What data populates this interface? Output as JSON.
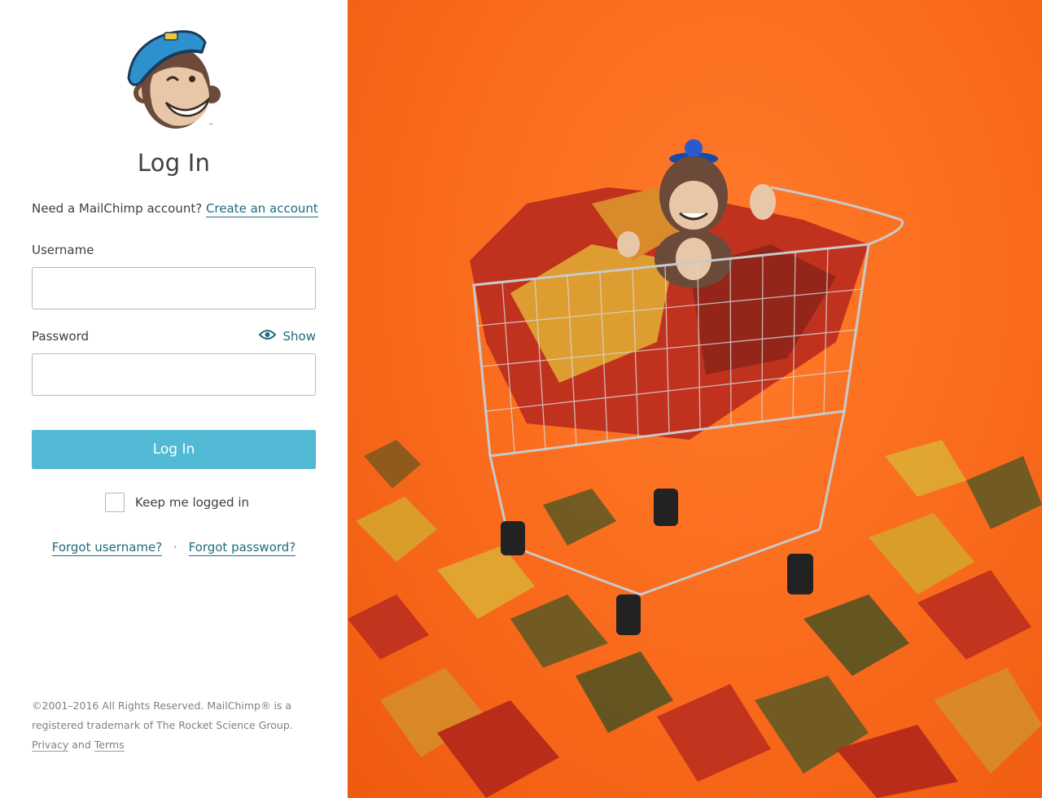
{
  "login": {
    "title": "Log In",
    "signup_prompt": "Need a MailChimp account?",
    "create_account_link": "Create an account",
    "username_label": "Username",
    "username_value": "",
    "password_label": "Password",
    "password_value": "",
    "show_label": "Show",
    "submit_label": "Log In",
    "keep_logged_in_label": "Keep me logged in",
    "forgot_username_link": "Forgot username?",
    "separator": "·",
    "forgot_password_link": "Forgot password?"
  },
  "footer": {
    "copyright_line1": "©2001–2016 All Rights Reserved. MailChimp® is a",
    "copyright_line2": "registered trademark of The Rocket Science Group.",
    "privacy_link": "Privacy",
    "and_text": "and",
    "terms_link": "Terms"
  },
  "icons": {
    "logo": "freddie-monkey-logo",
    "show_password": "eye-icon"
  },
  "colors": {
    "accent_link": "#1b6d7e",
    "button_bg": "#52bad5",
    "photo_background": "#f96a1c"
  }
}
